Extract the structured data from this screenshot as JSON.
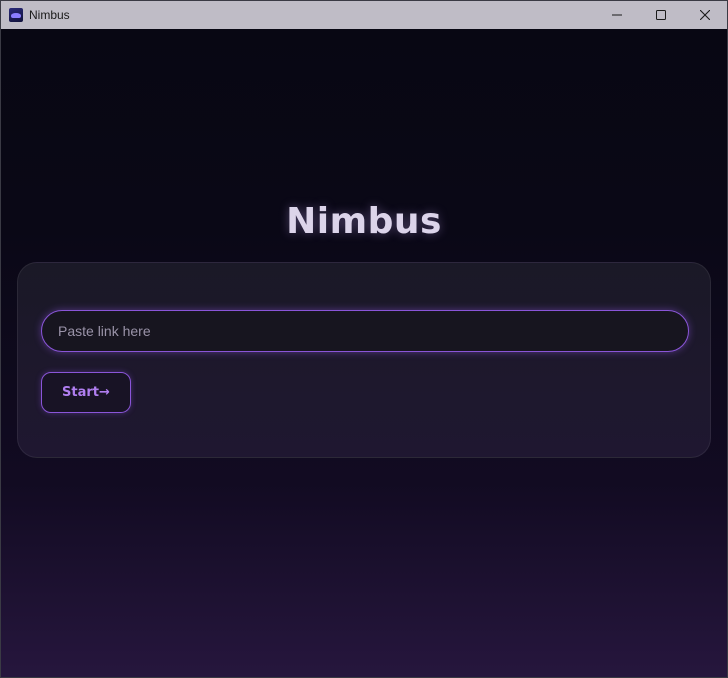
{
  "window": {
    "title": "Nimbus",
    "controls": {
      "minimize_icon": "minimize-icon",
      "maximize_icon": "maximize-icon",
      "close_icon": "close-icon"
    }
  },
  "main": {
    "heading": "Nimbus",
    "link_input": {
      "value": "",
      "placeholder": "Paste link here"
    },
    "start_button": {
      "label": "Start",
      "arrow": "→"
    }
  },
  "colors": {
    "accent": "#8a55d8",
    "button_text": "#b07ef0",
    "heading": "#dcd4ea",
    "background_top": "#080713",
    "background_bottom": "#26163d"
  }
}
